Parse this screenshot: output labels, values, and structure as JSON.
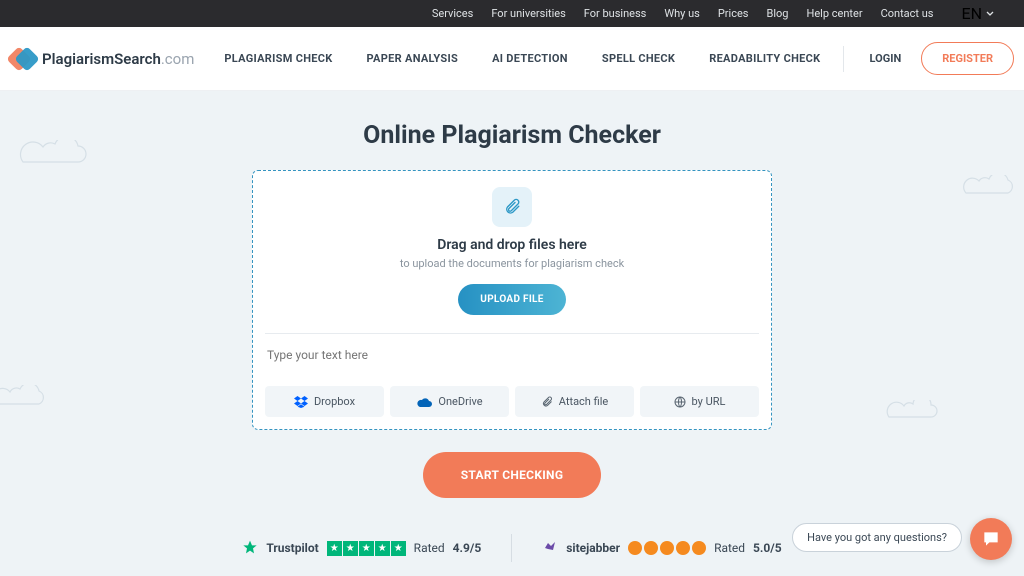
{
  "topnav": {
    "items": [
      "Services",
      "For universities",
      "For business",
      "Why us",
      "Prices",
      "Blog",
      "Help center",
      "Contact us"
    ],
    "lang": "EN"
  },
  "logo": {
    "name": "PlagiarismSearch",
    "suffix": ".com"
  },
  "mainnav": [
    "PLAGIARISM CHECK",
    "PAPER ANALYSIS",
    "AI DETECTION",
    "SPELL CHECK",
    "READABILITY CHECK"
  ],
  "auth": {
    "login": "LOGIN",
    "register": "REGISTER"
  },
  "hero": {
    "title": "Online Plagiarism Checker",
    "dnd_title": "Drag and drop files here",
    "dnd_sub": "to upload the documents for plagiarism check",
    "upload": "UPLOAD FILE",
    "text_placeholder": "Type your text here",
    "options": [
      "Dropbox",
      "OneDrive",
      "Attach file",
      "by URL"
    ],
    "start": "START CHECKING"
  },
  "reviews": {
    "trustpilot": {
      "name": "Trustpilot",
      "rated_label": "Rated",
      "score": "4.9/5"
    },
    "sitejabber": {
      "name": "sitejabber",
      "rated_label": "Rated",
      "score": "5.0/5"
    }
  },
  "chat": {
    "prompt": "Have you got any questions?"
  }
}
